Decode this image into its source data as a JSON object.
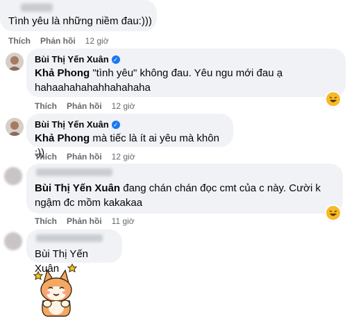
{
  "comments": [
    {
      "id": "c1",
      "author": "",
      "text": "Tình yêu là những niềm đau:)))",
      "actions": {
        "like": "Thích",
        "reply": "Phản hồi",
        "time": "12 giờ"
      }
    },
    {
      "id": "c2",
      "author": "Bùi Thị Yến Xuân",
      "mention": "Khả Phong",
      "text_line1": " \"tình yêu\" không đau. Yêu ngu mới đau ạ",
      "text_line2": "hahaahahahahhahahaha",
      "actions": {
        "like": "Thích",
        "reply": "Phản hồi",
        "time": "12 giờ"
      },
      "reaction": "haha"
    },
    {
      "id": "c3",
      "author": "Bùi Thị Yến Xuân",
      "mention": "Khả Phong",
      "text": " mà tiếc là ít ai yêu mà khôn :))",
      "actions": {
        "like": "Thích",
        "reply": "Phản hồi",
        "time": "12 giờ"
      }
    },
    {
      "id": "c4",
      "author": "",
      "mention": "Bùi Thị Yến Xuân",
      "text_line1": " đang chán chán đọc cmt của c này. Cười k",
      "text_line2": "ngậm đc mồm kakakaa",
      "actions": {
        "like": "Thích",
        "reply": "Phản hồi",
        "time": "11 giờ"
      },
      "reaction": "haha"
    },
    {
      "id": "c5",
      "author": "",
      "mention": "Bùi Thị Yến Xuân",
      "sticker": "shiba-dog-sticker"
    }
  ],
  "colors": {
    "bubble": "#f0f2f5",
    "meta": "#65676b",
    "verified": "#1877f2",
    "reaction": "#f7b928"
  }
}
